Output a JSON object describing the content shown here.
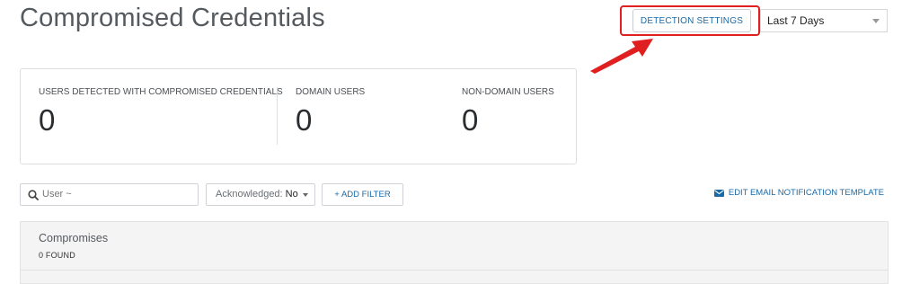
{
  "page": {
    "title": "Compromised Credentials"
  },
  "header": {
    "detection_settings_label": "DETECTION SETTINGS",
    "date_range": "Last 7 Days"
  },
  "stats": [
    {
      "label": "USERS DETECTED WITH COMPROMISED CREDENTIALS",
      "value": "0"
    },
    {
      "label": "DOMAIN USERS",
      "value": "0"
    },
    {
      "label": "NON-DOMAIN USERS",
      "value": "0"
    }
  ],
  "filters": {
    "search_label": "User ~",
    "acknowledged_label": "Acknowledged:",
    "acknowledged_value": "No",
    "add_filter_label": "+ ADD FILTER"
  },
  "email_template_link": "EDIT EMAIL NOTIFICATION TEMPLATE",
  "results": {
    "title": "Compromises",
    "count_label": "0 FOUND"
  },
  "colors": {
    "accent": "#1a6aa6",
    "annotation": "#e02020"
  },
  "icons": {
    "search": "search-icon",
    "email": "envelope-icon",
    "dropdown": "chevron-down-icon"
  }
}
